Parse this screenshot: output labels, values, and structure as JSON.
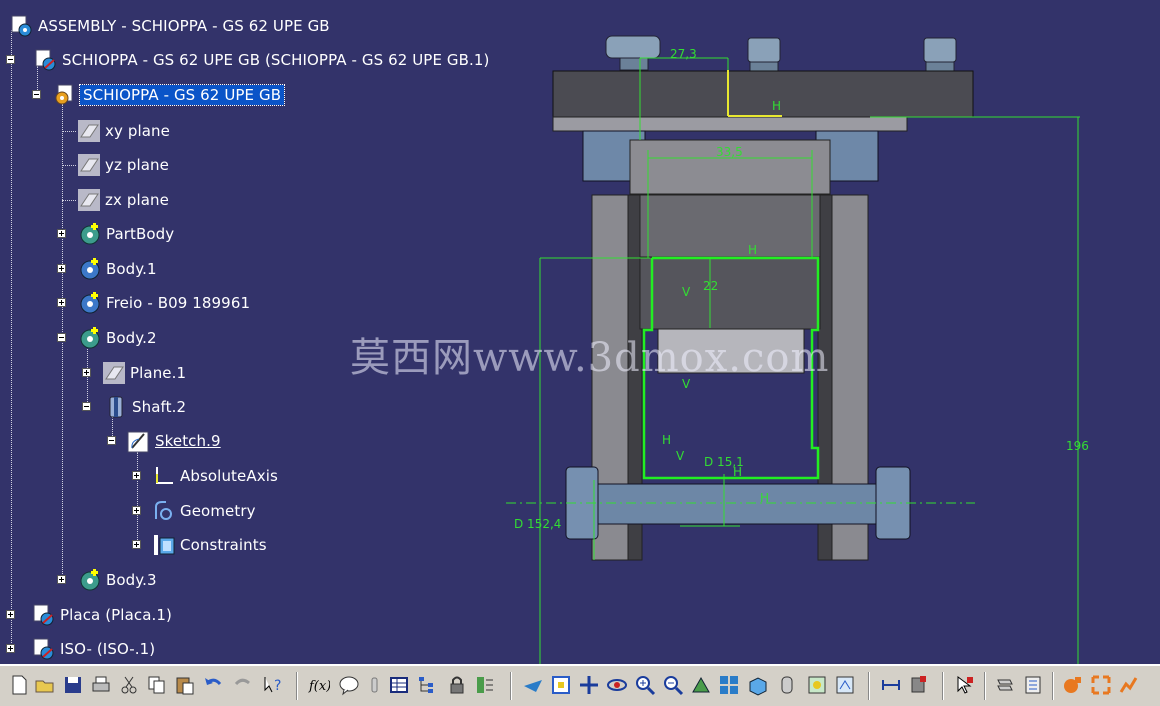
{
  "tree": {
    "nodes": [
      {
        "label": "ASSEMBLY - SCHIOPPA - GS 62 UPE GB",
        "icon": "assembly-icon"
      },
      {
        "label": "SCHIOPPA - GS 62 UPE GB (SCHIOPPA - GS 62 UPE GB.1)",
        "icon": "product-icon"
      },
      {
        "label": "SCHIOPPA - GS 62 UPE GB",
        "icon": "part-icon",
        "selected": true
      },
      {
        "label": "xy plane",
        "icon": "plane-icon"
      },
      {
        "label": "yz plane",
        "icon": "plane-icon"
      },
      {
        "label": "zx plane",
        "icon": "plane-icon"
      },
      {
        "label": "PartBody",
        "icon": "body-icon"
      },
      {
        "label": "Body.1",
        "icon": "body-icon"
      },
      {
        "label": "Freio - B09 189961",
        "icon": "body-icon"
      },
      {
        "label": "Body.2",
        "icon": "body-icon"
      },
      {
        "label": "Plane.1",
        "icon": "plane-icon"
      },
      {
        "label": "Shaft.2",
        "icon": "shaft-icon"
      },
      {
        "label": "Sketch.9",
        "icon": "sketch-icon",
        "underlined": true
      },
      {
        "label": "AbsoluteAxis",
        "icon": "axis-icon"
      },
      {
        "label": "Geometry",
        "icon": "geometry-icon"
      },
      {
        "label": "Constraints",
        "icon": "constraints-icon"
      },
      {
        "label": "Body.3",
        "icon": "body-icon"
      },
      {
        "label": "Placa (Placa.1)",
        "icon": "product-icon"
      },
      {
        "label": "ISO- (ISO-.1)",
        "icon": "product-icon"
      }
    ]
  },
  "sketch": {
    "dimensions": [
      "27,3",
      "H",
      "33,5",
      "22",
      "D 15,1",
      "H",
      "H",
      "D 152,4",
      "196",
      "V",
      "V",
      "H",
      "H",
      "V"
    ]
  },
  "watermark": "莫西网www.3dmox.com",
  "toolbar": {
    "buttons": [
      "new-icon",
      "open-icon",
      "save-icon",
      "print-icon",
      "cut-icon",
      "copy-icon",
      "paste-icon",
      "undo-icon",
      "redo-icon",
      "whats-this-icon",
      "formula-icon",
      "comment-icon",
      "sensor-icon",
      "table-icon",
      "tree-icon",
      "lock-icon",
      "parameters-icon",
      "fly-mode-icon",
      "fit-all-icon",
      "pan-icon",
      "rotate-icon",
      "zoom-in-icon",
      "zoom-out-icon",
      "normal-view-icon",
      "multi-view-icon",
      "iso-view-icon",
      "view-mode-icon",
      "hide-show-icon",
      "swap-visible-icon",
      "measure-icon",
      "apply-material-icon",
      "select-icon",
      "update-icon",
      "catalog-icon",
      "simulation-icon",
      "motion-icon",
      "snap-icon"
    ],
    "colors": {
      "accent": "#0a54c8",
      "viewport": "#33336a",
      "sketch": "#22ee22"
    }
  }
}
